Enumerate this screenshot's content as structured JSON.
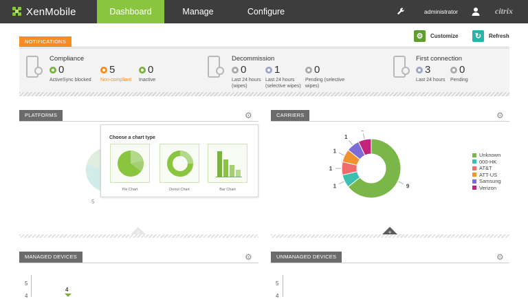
{
  "header": {
    "brand": "XenMobile",
    "tabs": [
      {
        "label": "Dashboard",
        "active": true
      },
      {
        "label": "Manage",
        "active": false
      },
      {
        "label": "Configure",
        "active": false
      }
    ],
    "user": "administrator",
    "vendor": "citrix",
    "accent_color": "#8ac53f"
  },
  "notifications": {
    "label": "NOTIFICATIONS",
    "customize_label": "Customize",
    "refresh_label": "Refresh",
    "groups": [
      {
        "title": "Compliance",
        "stats": [
          {
            "value": "0",
            "label": "ActiveSync blocked",
            "color": "green"
          },
          {
            "value": "5",
            "label": "Non-compliant",
            "color": "orange"
          },
          {
            "value": "0",
            "label": "Inactive",
            "color": "green"
          }
        ]
      },
      {
        "title": "Decommission",
        "stats": [
          {
            "value": "0",
            "label": "Last 24 hours (wipes)",
            "color": "grey"
          },
          {
            "value": "1",
            "label": "Last 24 hours (selective wipes)",
            "color": "blue"
          },
          {
            "value": "0",
            "label": "Pending (selective wipes)",
            "color": "grey"
          }
        ]
      },
      {
        "title": "First connection",
        "stats": [
          {
            "value": "3",
            "label": "Last 24 hours",
            "color": "blue"
          },
          {
            "value": "0",
            "label": "Pending",
            "color": "grey"
          }
        ]
      }
    ]
  },
  "panels": {
    "platforms": "PLATFORMS",
    "carriers": "CARRIERS",
    "managed": "MANAGED DEVICES",
    "unmanaged": "UNMANAGED DEVICES",
    "platforms_partial_value": "5"
  },
  "chart_picker": {
    "title": "Choose a chart type",
    "options": [
      "Pie Chart",
      "Donut Chart",
      "Bar Chart"
    ]
  },
  "carriers_chart": {
    "legend": [
      {
        "name": "Unknown",
        "color": "#7ab648"
      },
      {
        "name": "000-HK",
        "color": "#3bbfb0"
      },
      {
        "name": "AT&T",
        "color": "#f06b6b"
      },
      {
        "name": "ATT-US",
        "color": "#f2922e"
      },
      {
        "name": "Samsung",
        "color": "#7b6cd6"
      },
      {
        "name": "Verizon",
        "color": "#c2237d"
      }
    ]
  },
  "managed_chart": {
    "y_ticks": [
      "5",
      "4"
    ],
    "bar_label": "4"
  },
  "unmanaged_chart": {
    "y_ticks": [
      "5",
      "4"
    ]
  },
  "chart_data": {
    "type": "pie",
    "title": "CARRIERS",
    "categories": [
      "Unknown",
      "000-HK",
      "AT&T",
      "ATT-US",
      "Samsung",
      "Verizon"
    ],
    "values": [
      9,
      1,
      1,
      1,
      1,
      1
    ],
    "donut": true,
    "legend": "right"
  }
}
